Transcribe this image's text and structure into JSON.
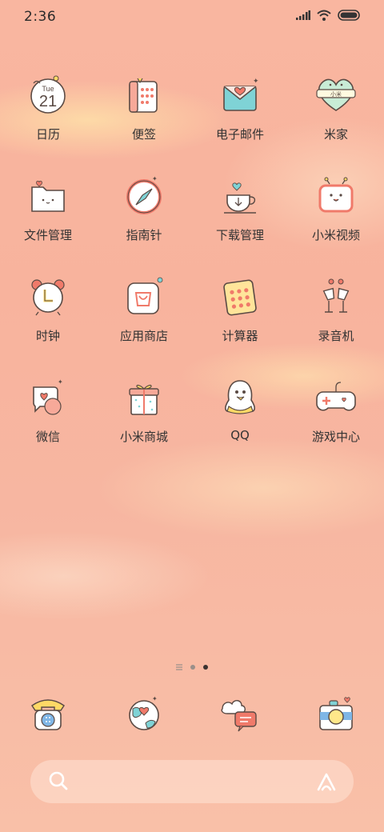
{
  "status_bar": {
    "time": "2:36"
  },
  "apps": [
    {
      "label": "日历",
      "icon": "calendar-icon",
      "day": "Tue",
      "date": "21"
    },
    {
      "label": "便签",
      "icon": "notes-icon"
    },
    {
      "label": "电子邮件",
      "icon": "email-icon"
    },
    {
      "label": "米家",
      "icon": "mijia-icon",
      "badge": "小米"
    },
    {
      "label": "文件管理",
      "icon": "folder-icon"
    },
    {
      "label": "指南针",
      "icon": "compass-icon"
    },
    {
      "label": "下载管理",
      "icon": "download-icon"
    },
    {
      "label": "小米视频",
      "icon": "video-icon"
    },
    {
      "label": "时钟",
      "icon": "clock-icon"
    },
    {
      "label": "应用商店",
      "icon": "app-store-icon"
    },
    {
      "label": "计算器",
      "icon": "calculator-icon"
    },
    {
      "label": "录音机",
      "icon": "recorder-icon"
    },
    {
      "label": "微信",
      "icon": "wechat-icon"
    },
    {
      "label": "小米商城",
      "icon": "mi-store-icon"
    },
    {
      "label": "QQ",
      "icon": "qq-icon"
    },
    {
      "label": "游戏中心",
      "icon": "game-center-icon"
    }
  ],
  "page_indicator": {
    "count": 2,
    "active": 1
  },
  "dock": [
    {
      "icon": "phone-icon"
    },
    {
      "icon": "browser-icon"
    },
    {
      "icon": "messages-icon"
    },
    {
      "icon": "camera-icon"
    }
  ],
  "colors": {
    "accent_red": "#f07a6a",
    "icon_outline": "#5a4a44",
    "yellow": "#ffd966",
    "teal": "#7fd3d6"
  }
}
